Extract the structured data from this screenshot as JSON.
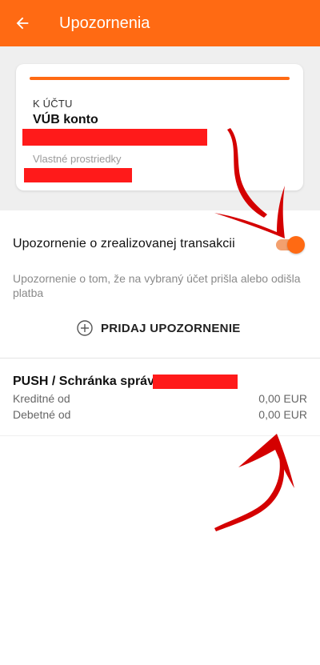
{
  "header": {
    "title": "Upozornenia",
    "back_icon": "arrow-left-icon"
  },
  "account_card": {
    "label": "K ÚČTU",
    "account_name": "VÚB konto",
    "sub_label": "Vlastné prostriedky"
  },
  "notification": {
    "label": "Upozornenie o zrealizovanej transakcii",
    "enabled": true,
    "description": "Upozornenie o tom, že na vybraný účet prišla alebo odišla platba",
    "add_button_label": "PRIDAJ UPOZORNENIE"
  },
  "push": {
    "title": "PUSH / Schránka správ",
    "rows": [
      {
        "label": "Kreditné od",
        "value": "0,00 EUR"
      },
      {
        "label": "Debetné od",
        "value": "0,00 EUR"
      }
    ]
  },
  "colors": {
    "accent": "#ff6a13",
    "redaction": "#ff1a1a",
    "annotation_arrow": "#d40000"
  }
}
